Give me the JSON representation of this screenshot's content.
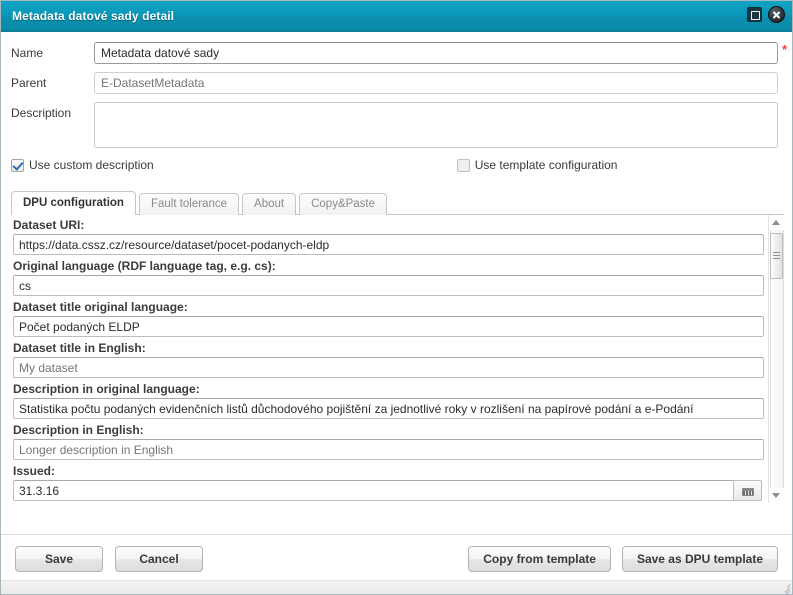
{
  "window": {
    "title": "Metadata datové sady detail",
    "maximize_label": "Maximize",
    "close_label": "Close"
  },
  "form": {
    "name_label": "Name",
    "name_value": "Metadata datové sady",
    "name_required_marker": "*",
    "parent_label": "Parent",
    "parent_placeholder": "E-DatasetMetadata",
    "parent_value": "",
    "description_label": "Description",
    "description_value": "",
    "description_placeholder": ""
  },
  "options": {
    "use_custom_description_label": "Use custom description",
    "use_custom_description_checked": true,
    "use_template_configuration_label": "Use template configuration",
    "use_template_configuration_checked": false
  },
  "tabs": [
    {
      "label": "DPU configuration",
      "active": true
    },
    {
      "label": "Fault tolerance",
      "active": false
    },
    {
      "label": "About",
      "active": false
    },
    {
      "label": "Copy&Paste",
      "active": false
    }
  ],
  "config_fields": [
    {
      "label": "Dataset URI:",
      "value": "https://data.cssz.cz/resource/dataset/pocet-podanych-eldp",
      "placeholder": "",
      "is_placeholder": false
    },
    {
      "label": "Original language (RDF language tag, e.g. cs):",
      "value": "cs",
      "placeholder": "",
      "is_placeholder": false
    },
    {
      "label": "Dataset title original language:",
      "value": "Počet podaných ELDP",
      "placeholder": "",
      "is_placeholder": false
    },
    {
      "label": "Dataset title in English:",
      "value": "",
      "placeholder": "My dataset",
      "is_placeholder": true
    },
    {
      "label": "Description in original language:",
      "value": "Statistika počtu podaných evidenčních listů důchodového pojištění za jednotlivé roky v rozlišení na papírové podání a e-Podání",
      "placeholder": "",
      "is_placeholder": false
    },
    {
      "label": "Description in English:",
      "value": "",
      "placeholder": "Longer description in English",
      "is_placeholder": true
    }
  ],
  "issued": {
    "label": "Issued:",
    "value": "31.3.16",
    "calendar_icon": "calendar-icon"
  },
  "scrollbar": {
    "up_arrow_icon": "chevron-up-icon",
    "down_arrow_icon": "chevron-down-icon",
    "position": "top"
  },
  "footer": {
    "save_label": "Save",
    "cancel_label": "Cancel",
    "copy_from_template_label": "Copy from template",
    "save_as_dpu_template_label": "Save as DPU template"
  },
  "colors": {
    "titlebar_accent": "#0b99ba",
    "titlebar_border": "#0f7f99",
    "required_star": "#e8453c",
    "checkbox_check": "#2f6fb5",
    "placeholder_text": "#b2b2b2"
  }
}
